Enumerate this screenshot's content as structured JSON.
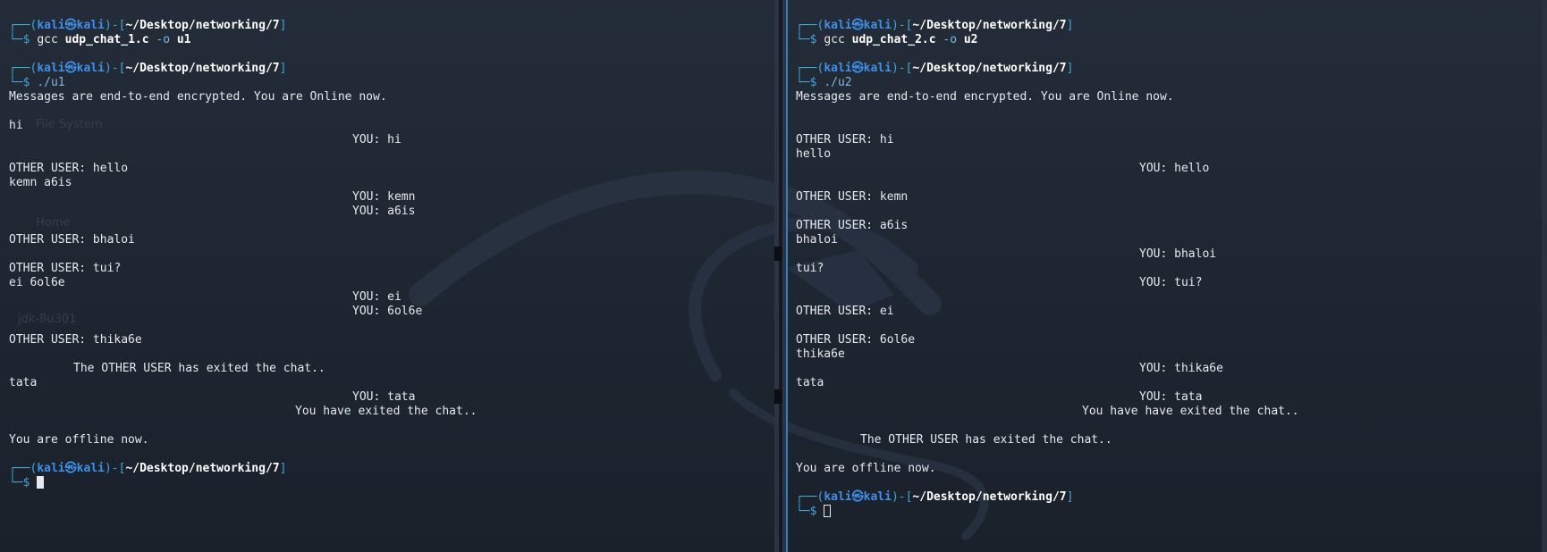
{
  "prompt": {
    "open": "┌──(",
    "user": "kali㉿kali",
    "mid": ")-[",
    "path": "~/Desktop/networking/7",
    "close": "]",
    "dollar_prefix": "└─$ "
  },
  "desktop_ghosts": [
    "File System",
    "Home",
    "jdk-8u301"
  ],
  "left_terminal": {
    "cmd1": {
      "word": "gcc",
      "file": "udp_chat_1.c",
      "opt": "-o",
      "out": "u1"
    },
    "cmd2": "./u1",
    "lines": [
      "Messages are end-to-end encrypted. You are Online now.",
      "hi",
      "YOU: hi",
      "OTHER USER: hello",
      "kemn a6is",
      "YOU: kemn",
      "YOU: a6is",
      "OTHER USER: bhaloi",
      "OTHER USER: tui?",
      "ei 6ol6e",
      "YOU: ei",
      "YOU: 6ol6e",
      "OTHER USER: thika6e",
      "The OTHER USER has exited the chat..",
      "tata",
      "YOU: tata",
      "You have exited the chat..",
      "You are offline now."
    ]
  },
  "right_terminal": {
    "cmd1": {
      "word": "gcc",
      "file": "udp_chat_2.c",
      "opt": "-o",
      "out": "u2"
    },
    "cmd2": "./u2",
    "lines": [
      "Messages are end-to-end encrypted. You are Online now.",
      "OTHER USER: hi",
      "hello",
      "YOU: hello",
      "OTHER USER: kemn",
      "OTHER USER: a6is",
      "bhaloi",
      "YOU: bhaloi",
      "tui?",
      "YOU: tui?",
      "OTHER USER: ei",
      "OTHER USER: 6ol6e",
      "thika6e",
      "YOU: thika6e",
      "tata",
      "YOU: tata",
      "You have have exited the chat..",
      "The OTHER USER has exited the chat..",
      "You are offline now."
    ]
  },
  "colors": {
    "background": "#1f2733",
    "prompt_frame": "#3fa7d6",
    "prompt_user": "#3f8fe8",
    "text": "#e6e9ee",
    "pane_highlight": "#2f7ec2"
  }
}
